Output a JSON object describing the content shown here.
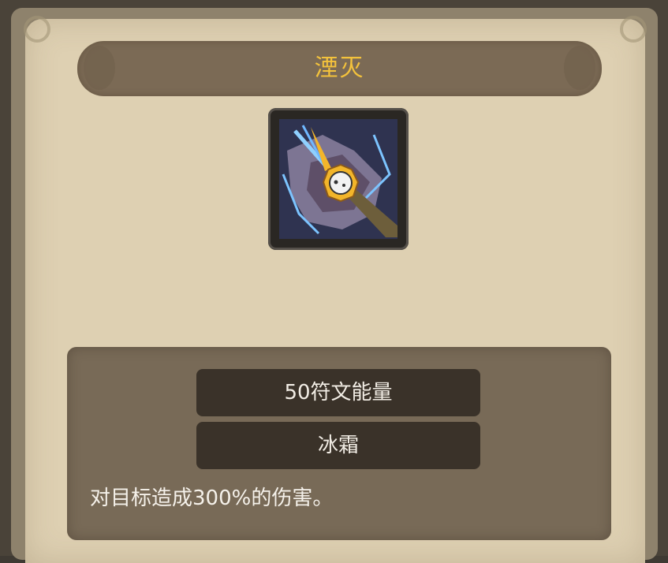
{
  "skill": {
    "name": "湮灭",
    "icon": "annihilation-skill-icon",
    "cost": "50符文能量",
    "element": "冰霜",
    "description": "对目标造成300%的伤害。"
  },
  "colors": {
    "title": "#f3c23c",
    "parchment": "#ded0b2",
    "panel": "#786a57",
    "pill": "#3a3229",
    "text": "#f5f1ea"
  }
}
